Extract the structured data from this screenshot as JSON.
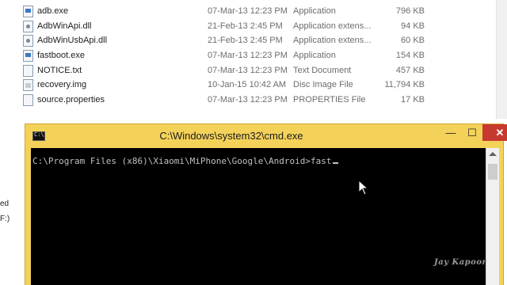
{
  "explorer": {
    "files": [
      {
        "name": "adb.exe",
        "date": "07-Mar-13 12:23 PM",
        "type": "Application",
        "size": "796 KB",
        "icon": "app-icon"
      },
      {
        "name": "AdbWinApi.dll",
        "date": "21-Feb-13 2:45 PM",
        "type": "Application extens...",
        "size": "94 KB",
        "icon": "dll-icon"
      },
      {
        "name": "AdbWinUsbApi.dll",
        "date": "21-Feb-13 2:45 PM",
        "type": "Application extens...",
        "size": "60 KB",
        "icon": "dll-icon"
      },
      {
        "name": "fastboot.exe",
        "date": "07-Mar-13 12:23 PM",
        "type": "Application",
        "size": "154 KB",
        "icon": "app-icon"
      },
      {
        "name": "NOTICE.txt",
        "date": "07-Mar-13 12:23 PM",
        "type": "Text Document",
        "size": "457 KB",
        "icon": "text-file-icon"
      },
      {
        "name": "recovery.img",
        "date": "10-Jan-15 10:42 AM",
        "type": "Disc Image File",
        "size": "11,794 KB",
        "icon": "disc-image-icon"
      },
      {
        "name": "source.properties",
        "date": "07-Mar-13 12:23 PM",
        "type": "PROPERTIES File",
        "size": "17 KB",
        "icon": "file-icon"
      }
    ],
    "left_pane": {
      "snippet_1": "ed",
      "snippet_2": "F:)"
    }
  },
  "cmd": {
    "title": "C:\\Windows\\system32\\cmd.exe",
    "minimize_label": "—",
    "maximize_label": "☐",
    "close_label": "✕",
    "prompt": "C:\\Program Files (x86)\\Xiaomi\\MiPhone\\Google\\Android>",
    "typed": "fast"
  },
  "watermark": "Jay Kapoor",
  "colors": {
    "cmd_frame": "#f4d25a",
    "close_button": "#c7392f",
    "console_bg": "#000000",
    "console_text": "#c0c0c0"
  }
}
